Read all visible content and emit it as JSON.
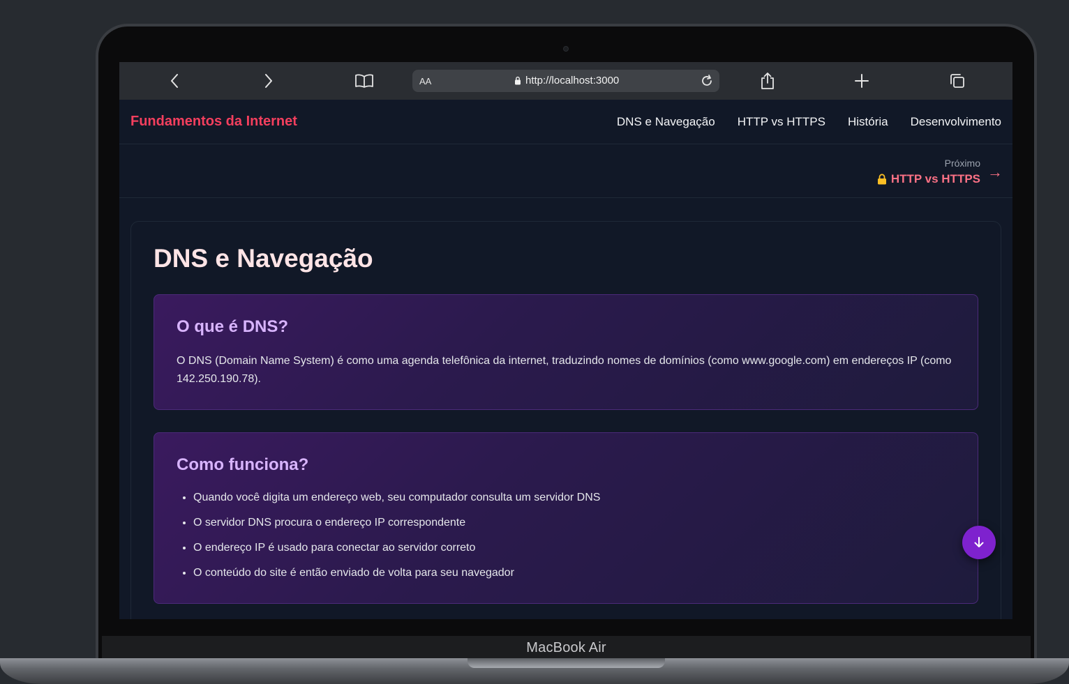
{
  "device": {
    "label": "MacBook Air"
  },
  "browser": {
    "aa_label": "AA",
    "url": "http://localhost:3000",
    "icons": [
      "back-icon",
      "forward-icon",
      "bookmarks-icon",
      "lock-icon",
      "reload-icon",
      "share-icon",
      "new-tab-icon",
      "tabs-icon"
    ]
  },
  "site": {
    "brand": "Fundamentos da Internet",
    "nav": [
      "DNS e Navegação",
      "HTTP vs HTTPS",
      "História",
      "Desenvolvimento"
    ]
  },
  "next": {
    "label": "Próximo",
    "title": "HTTP vs HTTPS",
    "arrow": "→"
  },
  "content": {
    "title": "DNS e Navegação",
    "sections": [
      {
        "title": "O que é DNS?",
        "text": "O DNS (Domain Name System) é como uma agenda telefônica da internet, traduzindo nomes de domínios (como www.google.com) em endereços IP (como 142.250.190.78)."
      },
      {
        "title": "Como funciona?",
        "items": [
          "Quando você digita um endereço web, seu computador consulta um servidor DNS",
          "O servidor DNS procura o endereço IP correspondente",
          "O endereço IP é usado para conectar ao servidor correto",
          "O conteúdo do site é então enviado de volta para seu navegador"
        ]
      }
    ]
  },
  "colors": {
    "brand": "#f43f5e",
    "accent_link": "#fb7185",
    "section_title": "#d8b4fe",
    "page_title": "#ffe4e6",
    "fab": "#7e22ce"
  }
}
